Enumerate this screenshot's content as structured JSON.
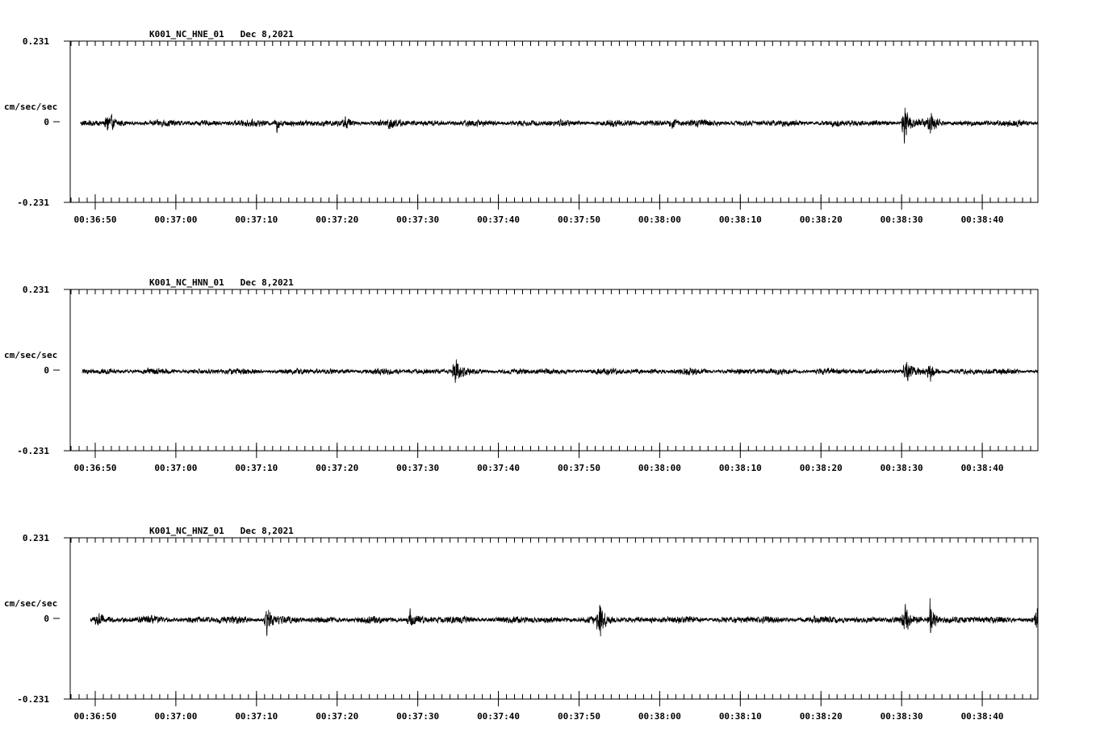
{
  "chart_data": [
    {
      "type": "line",
      "title": "K001_NC_HNE_01   Dec 8,2021",
      "ylabel": "cm/sec/sec",
      "ylim": [
        -0.231,
        0.231
      ],
      "ytick_labels": [
        "0.231",
        "0",
        "-0.231"
      ],
      "xtick_labels": [
        "00:36:50",
        "00:37:00",
        "00:37:10",
        "00:37:20",
        "00:37:30",
        "00:37:40",
        "00:37:50",
        "00:38:00",
        "00:38:10",
        "00:38:20",
        "00:38:30",
        "00:38:40"
      ],
      "xtick_seconds": [
        0,
        10,
        20,
        30,
        40,
        50,
        60,
        70,
        80,
        90,
        100,
        110
      ],
      "xlim_seconds": [
        -3.1,
        116.9
      ],
      "trace_start_seconds": -1.8,
      "noise_amplitude": 0.012,
      "events": [
        {
          "t": 1.5,
          "amp": 0.04
        },
        {
          "t": 22.5,
          "amp": 0.025
        },
        {
          "t": 31.0,
          "amp": 0.02
        },
        {
          "t": 36.5,
          "amp": 0.02
        },
        {
          "t": 71.5,
          "amp": 0.02
        },
        {
          "t": 100.3,
          "amp": 0.085
        },
        {
          "t": 103.5,
          "amp": 0.04
        }
      ]
    },
    {
      "type": "line",
      "title": "K001_NC_HNN_01   Dec 8,2021",
      "ylabel": "cm/sec/sec",
      "ylim": [
        -0.231,
        0.231
      ],
      "ytick_labels": [
        "0.231",
        "0",
        "-0.231"
      ],
      "xtick_labels": [
        "00:36:50",
        "00:37:00",
        "00:37:10",
        "00:37:20",
        "00:37:30",
        "00:37:40",
        "00:37:50",
        "00:38:00",
        "00:38:10",
        "00:38:20",
        "00:38:30",
        "00:38:40"
      ],
      "xtick_seconds": [
        0,
        10,
        20,
        30,
        40,
        50,
        60,
        70,
        80,
        90,
        100,
        110
      ],
      "xlim_seconds": [
        -3.1,
        116.9
      ],
      "trace_start_seconds": -1.6,
      "noise_amplitude": 0.011,
      "events": [
        {
          "t": 44.6,
          "amp": 0.055
        },
        {
          "t": 100.5,
          "amp": 0.04
        },
        {
          "t": 103.5,
          "amp": 0.03
        }
      ]
    },
    {
      "type": "line",
      "title": "K001_NC_HNZ_01   Dec 8,2021",
      "ylabel": "cm/sec/sec",
      "ylim": [
        -0.231,
        0.231
      ],
      "ytick_labels": [
        "0.231",
        "0",
        "-0.231"
      ],
      "xtick_labels": [
        "00:36:50",
        "00:37:00",
        "00:37:10",
        "00:37:20",
        "00:37:30",
        "00:37:40",
        "00:37:50",
        "00:38:00",
        "00:38:10",
        "00:38:20",
        "00:38:30",
        "00:38:40"
      ],
      "xtick_seconds": [
        0,
        10,
        20,
        30,
        40,
        50,
        60,
        70,
        80,
        90,
        100,
        110
      ],
      "xlim_seconds": [
        -3.1,
        116.9
      ],
      "trace_start_seconds": -0.6,
      "noise_amplitude": 0.013,
      "events": [
        {
          "t": 0.2,
          "amp": 0.03
        },
        {
          "t": 21.2,
          "amp": 0.06
        },
        {
          "t": 39.0,
          "amp": 0.03
        },
        {
          "t": 62.5,
          "amp": 0.07
        },
        {
          "t": 100.3,
          "amp": 0.05
        },
        {
          "t": 103.5,
          "amp": 0.065
        },
        {
          "t": 116.7,
          "amp": 0.05
        }
      ]
    }
  ]
}
